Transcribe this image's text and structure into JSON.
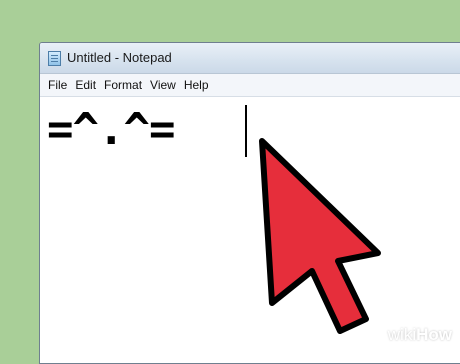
{
  "window": {
    "title": "Untitled - Notepad"
  },
  "menubar": {
    "items": [
      {
        "label": "File"
      },
      {
        "label": "Edit"
      },
      {
        "label": "Format"
      },
      {
        "label": "View"
      },
      {
        "label": "Help"
      }
    ]
  },
  "editor": {
    "text": "=^.^="
  },
  "cursor_icon": "mouse-pointer-arrow-icon",
  "colors": {
    "background": "#a9cf98",
    "cursor_fill": "#e62e3b",
    "cursor_outline": "#000000"
  },
  "watermark": {
    "prefix": "wiki",
    "suffix": "How"
  }
}
